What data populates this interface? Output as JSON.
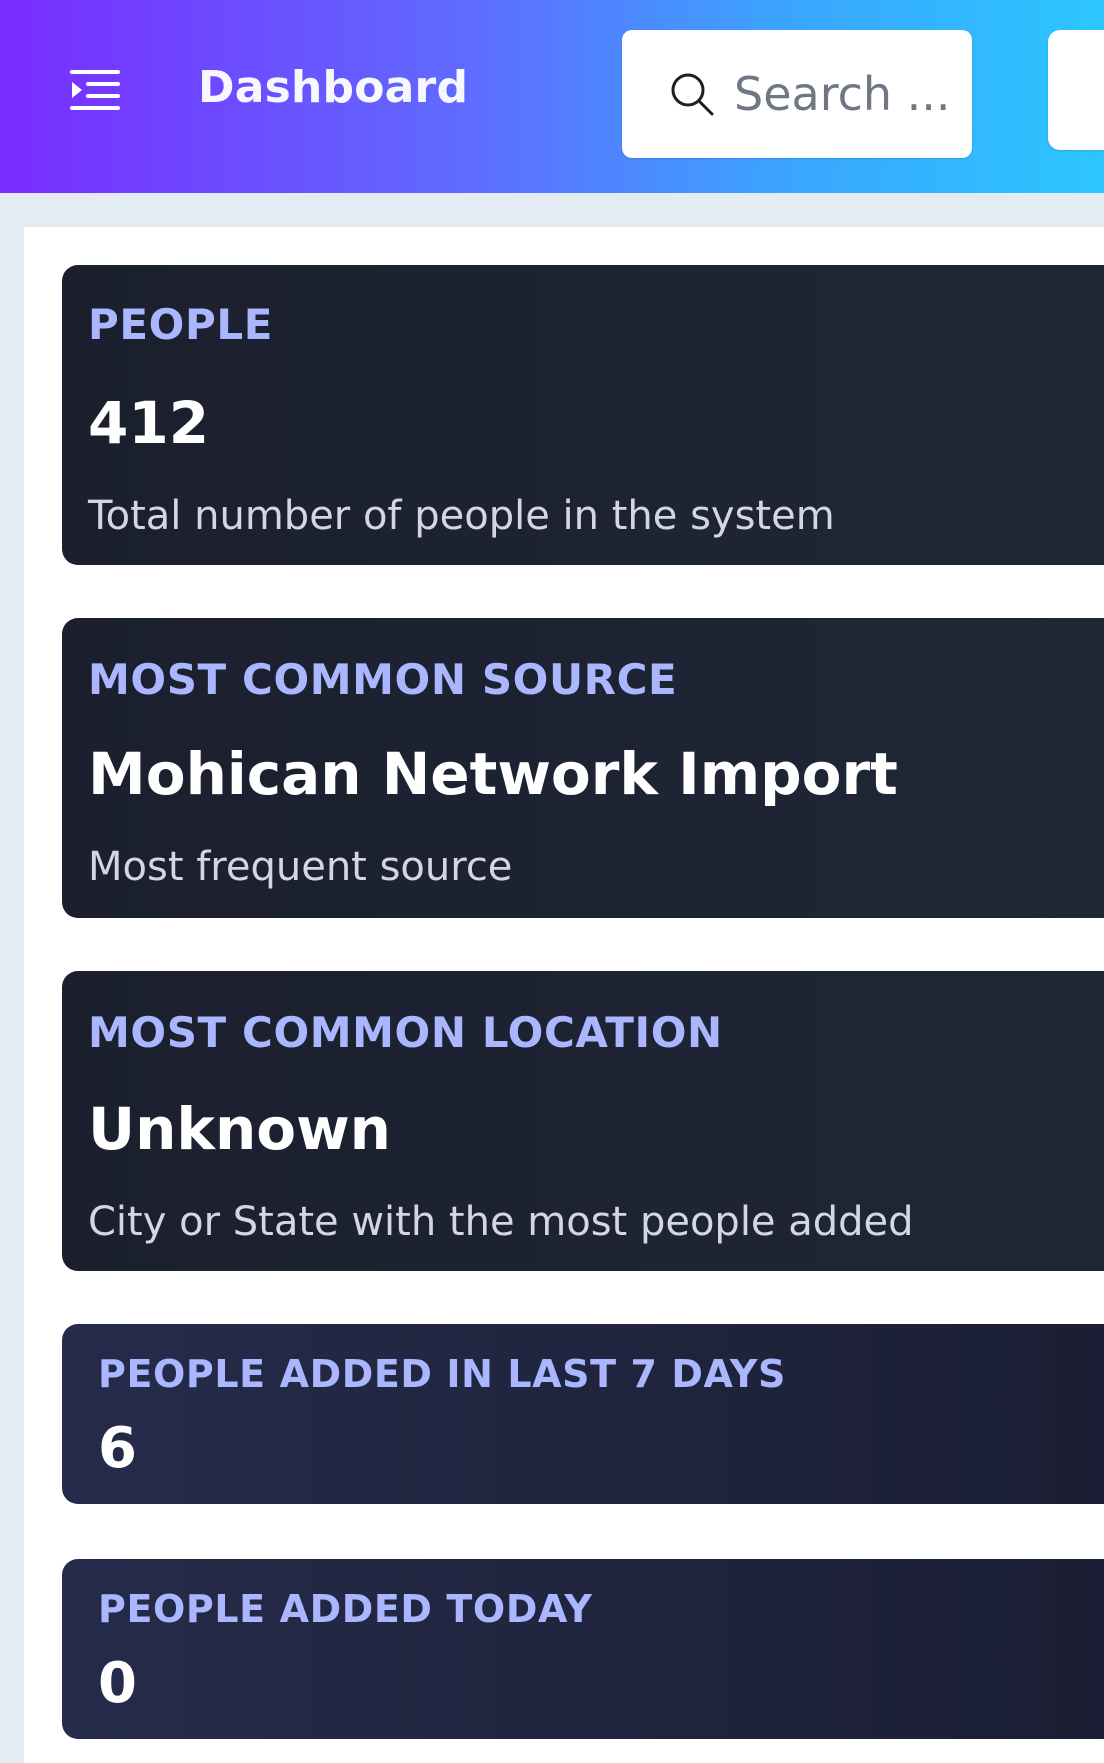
{
  "header": {
    "title": "Dashboard",
    "search_placeholder": "Search ..."
  },
  "cards": [
    {
      "label": "PEOPLE",
      "value": "412",
      "description": "Total number of people in the system"
    },
    {
      "label": "MOST COMMON SOURCE",
      "value": "Mohican Network Import",
      "description": "Most frequent source"
    },
    {
      "label": "MOST COMMON LOCATION",
      "value": "Unknown",
      "description": "City or State with the most people added"
    },
    {
      "label": "PEOPLE ADDED IN LAST 7 DAYS",
      "value": "6"
    },
    {
      "label": "PEOPLE ADDED TODAY",
      "value": "0"
    }
  ],
  "icons": {
    "menu": "menu-indent-icon",
    "search": "search-icon"
  }
}
